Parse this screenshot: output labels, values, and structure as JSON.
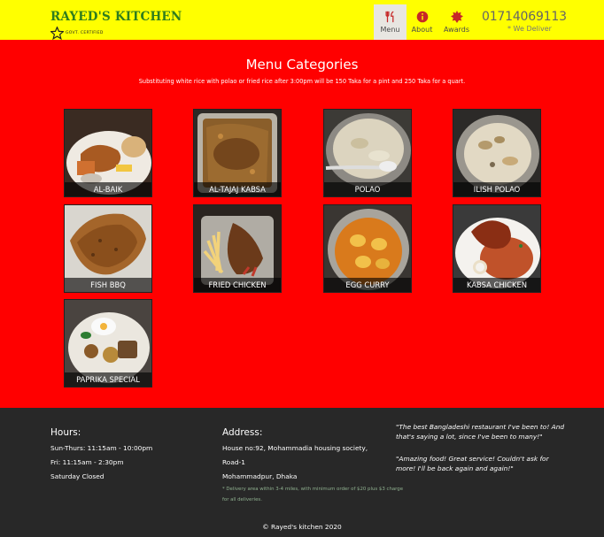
{
  "header": {
    "brand": "RAYED'S KITCHEN",
    "certified": "GOVT. CERTIFIED",
    "nav": [
      {
        "label": "Menu",
        "icon": "utensils-icon"
      },
      {
        "label": "About",
        "icon": "info-icon"
      },
      {
        "label": "Awards",
        "icon": "badge-icon"
      }
    ],
    "phone": "01714069113",
    "deliver_note": "* We Deliver"
  },
  "main": {
    "title": "Menu Categories",
    "subtitle": "Substituting white rice with polao or fried rice after 3:00pm will be 150 Taka for a pint and 250 Taka for a quart.",
    "categories": [
      {
        "label": "AL-BAIK"
      },
      {
        "label": "AL-TAJAJ KABSA"
      },
      {
        "label": "POLAO"
      },
      {
        "label": "ILISH POLAO"
      },
      {
        "label": "FISH BBQ"
      },
      {
        "label": "FRIED CHICKEN"
      },
      {
        "label": "EGG CURRY"
      },
      {
        "label": "KABSA CHICKEN"
      },
      {
        "label": "PAPRIKA SPECIAL"
      }
    ]
  },
  "footer": {
    "hours_title": "Hours:",
    "hours": [
      "Sun-Thurs: 11:15am - 10:00pm",
      "Fri: 11:15am - 2:30pm",
      "Saturday Closed"
    ],
    "address_title": "Address:",
    "address": [
      "House no:92, Mohammadia housing society,",
      "Road-1",
      "Mohammadpur, Dhaka"
    ],
    "delivery_note": "* Delivery area within 3-4 miles, with minimum order of $20 plus $3 charge for all deliveries.",
    "quotes": [
      "\"The best Bangladeshi restaurant I've been to! And that's saying a lot, since I've been to many!\"",
      "\"Amazing food! Great service! Couldn't ask for more! I'll be back again and again!\""
    ],
    "copyright": "© Rayed's kitchen 2020"
  },
  "colors": {
    "header_bg": "#ffff00",
    "page_bg": "#ff0000",
    "footer_bg": "#282828",
    "brand": "#2f7d1e",
    "icon_accent": "#c62828"
  }
}
